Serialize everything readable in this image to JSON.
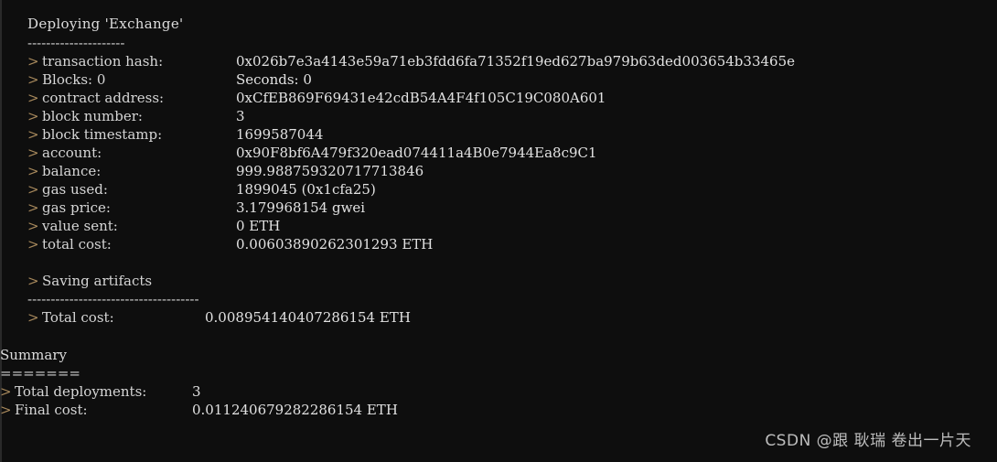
{
  "theme": {
    "background": "#0e0e0e",
    "text_color": "#d6d6d6",
    "chevron_color": "#a8895c",
    "watermark_color": "#bdbdbd",
    "edge_color": "#2a2a2a"
  },
  "deployment": {
    "title": "Deploying 'Exchange'",
    "title_rule": "---------------------",
    "chevron": ">",
    "rows": [
      {
        "label": "transaction hash:",
        "value": "0x026b7e3a4143e59a71eb3fdd6fa71352f19ed627ba979b63ded003654b33465e"
      },
      {
        "label": "Blocks: 0",
        "value": "Seconds: 0"
      },
      {
        "label": "contract address:",
        "value": "0xCfEB869F69431e42cdB54A4F4f105C19C080A601"
      },
      {
        "label": "block number:",
        "value": "3"
      },
      {
        "label": "block timestamp:",
        "value": "1699587044"
      },
      {
        "label": "account:",
        "value": "0x90F8bf6A479f320ead074411a4B0e7944Ea8c9C1"
      },
      {
        "label": "balance:",
        "value": "999.988759320717713846"
      },
      {
        "label": "gas used:",
        "value": "1899045 (0x1cfa25)"
      },
      {
        "label": "gas price:",
        "value": "3.179968154 gwei"
      },
      {
        "label": "value sent:",
        "value": "0 ETH"
      },
      {
        "label": "total cost:",
        "value": "0.00603890262301293 ETH"
      }
    ],
    "saving_artifacts": "Saving artifacts",
    "saving_rule": "-------------------------------------",
    "total_cost_label": "Total cost:",
    "total_cost_value": "0.008954140407286154 ETH"
  },
  "summary": {
    "title": "Summary",
    "rule": "=======",
    "chevron": ">",
    "rows": [
      {
        "label": "Total deployments:",
        "value": "3"
      },
      {
        "label": "Final cost:",
        "value": "0.011240679282286154 ETH"
      }
    ]
  },
  "watermark": {
    "text": "CSDN @跟 耿瑞 卷出一片天"
  }
}
